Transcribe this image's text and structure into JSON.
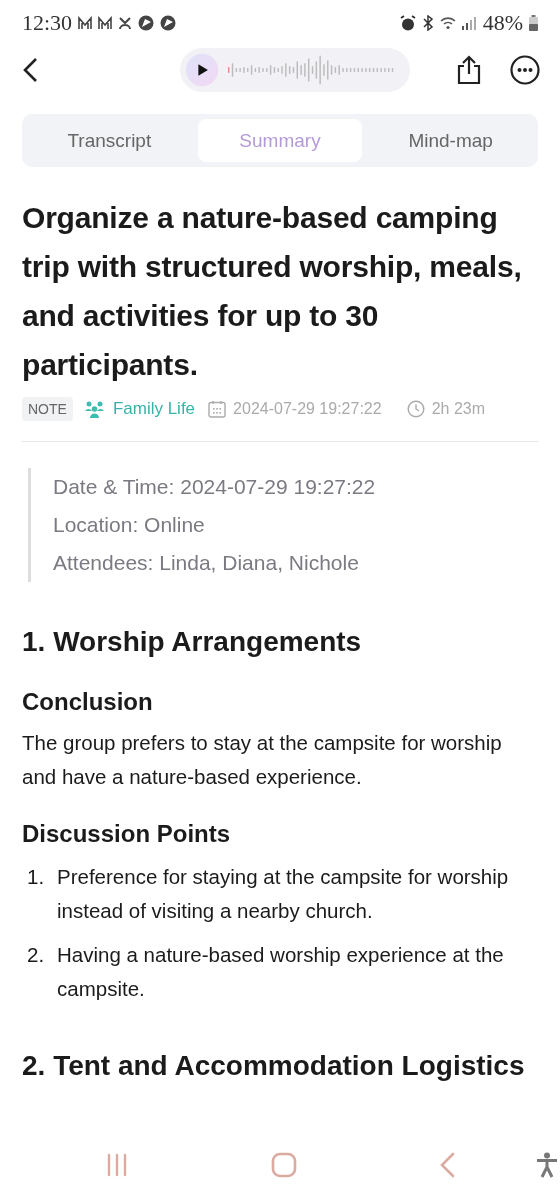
{
  "status_bar": {
    "time": "12:30",
    "battery": "48%"
  },
  "tabs": [
    {
      "label": "Transcript",
      "selected": false
    },
    {
      "label": "Summary",
      "selected": true
    },
    {
      "label": "Mind-map",
      "selected": false
    }
  ],
  "title": "Organize a nature-based camping trip with structured worship, meals, and activities for up to 30 participants.",
  "meta": {
    "tag": "NOTE",
    "category": "Family Life",
    "datetime": "2024-07-29 19:27:22",
    "duration": "2h 23m"
  },
  "info": [
    "Date & Time:  2024-07-29 19:27:22",
    "Location: Online",
    "Attendees: Linda, Diana, Nichole"
  ],
  "sections": [
    {
      "heading": "1. Worship Arrangements",
      "blocks": [
        {
          "kind": "subheading",
          "text": "Conclusion"
        },
        {
          "kind": "paragraph",
          "text": "The group prefers to stay at the campsite for worship and have a nature-based experience."
        },
        {
          "kind": "subheading",
          "text": "Discussion Points"
        },
        {
          "kind": "list",
          "items": [
            {
              "number": "1.",
              "text": "Preference for staying at the campsite for worship instead of visiting a nearby church."
            },
            {
              "number": "2.",
              "text": "Having a nature-based worship experience at the campsite."
            }
          ]
        }
      ]
    },
    {
      "heading": "2. Tent and Accommodation Logistics"
    }
  ]
}
